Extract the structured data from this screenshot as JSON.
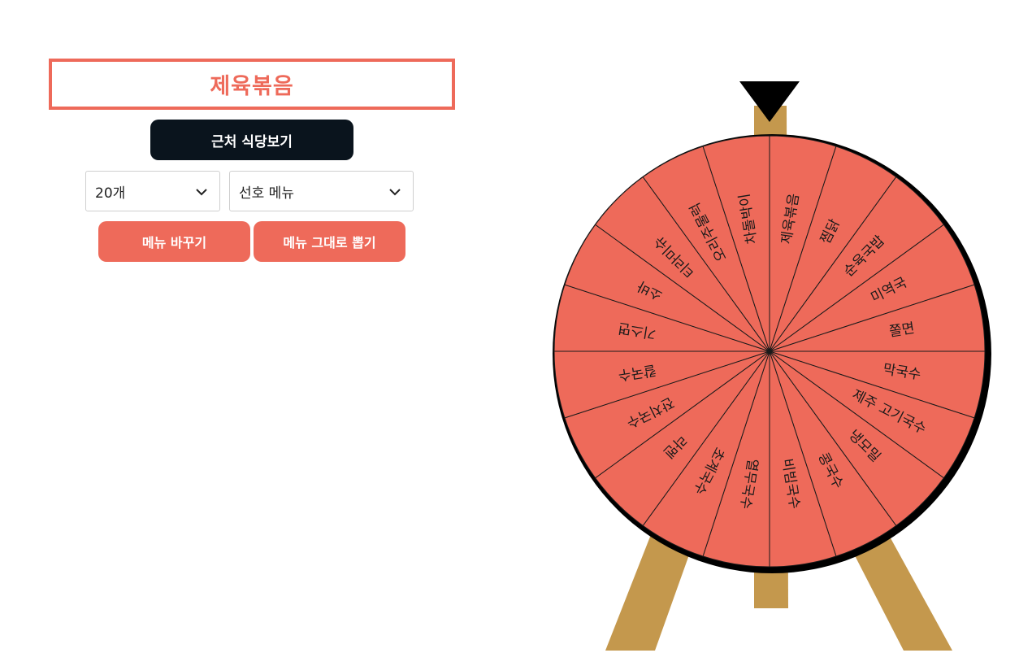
{
  "result": {
    "text": "제육볶음"
  },
  "nearby_button": {
    "label": "근처 식당보기"
  },
  "count_select": {
    "value": "20개"
  },
  "preference_select": {
    "value": "선호 메뉴"
  },
  "actions": {
    "change_menu": "메뉴 바꾸기",
    "pick_as_is": "메뉴 그대로 뽑기"
  },
  "wheel": {
    "segments": [
      "제육볶음",
      "찜닭",
      "순육국밥",
      "미역국",
      "쫄면",
      "막국수",
      "제주 고기국수",
      "냉모밀",
      "콩국수",
      "비빔국수",
      "열무국수",
      "초계국수",
      "라멘",
      "잔치국수",
      "칼국수",
      "기스면",
      "소바",
      "티라미슈",
      "오리주물럭",
      "차돌박이"
    ],
    "colors": {
      "slice": "#ee6a5a",
      "rim": "#000000",
      "stand": "#c4984d",
      "pointer": "#000000"
    }
  }
}
